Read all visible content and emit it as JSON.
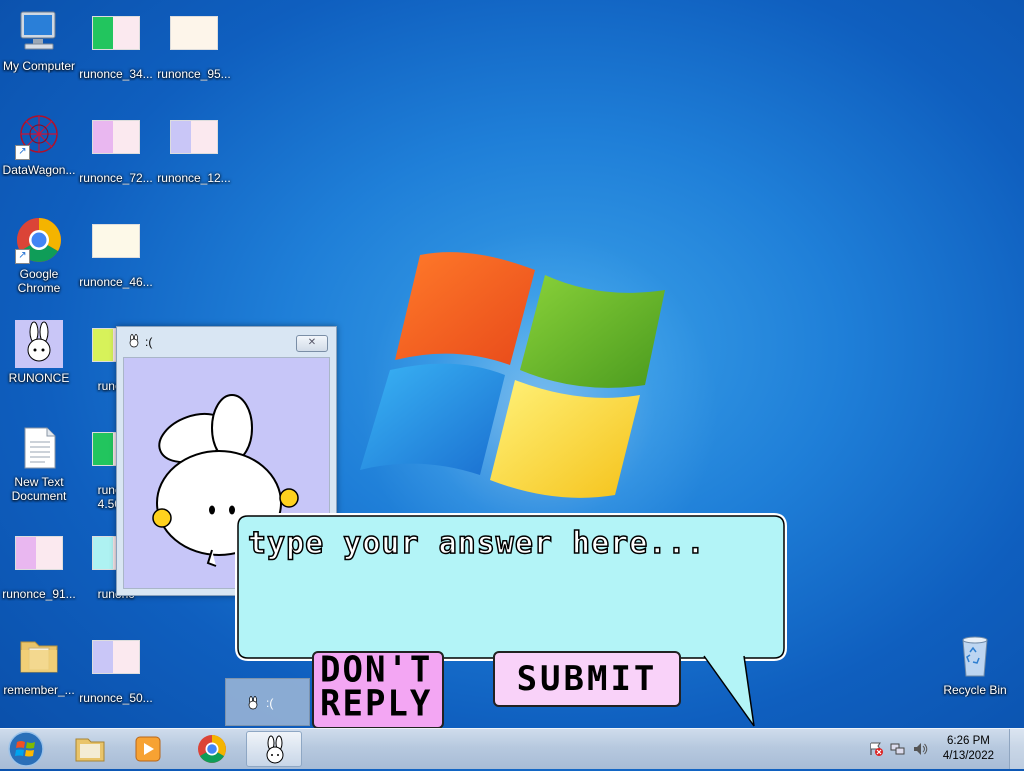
{
  "desktop": {
    "icons": [
      {
        "label": "My Computer"
      },
      {
        "label": "runonce_34..."
      },
      {
        "label": "runonce_95..."
      },
      {
        "label": "DataWagon..."
      },
      {
        "label": "runonce_72..."
      },
      {
        "label": "runonce_12..."
      },
      {
        "label": "Google Chrome"
      },
      {
        "label": "runonce_46..."
      },
      {
        "label": "RUNONCE"
      },
      {
        "label": "runonc"
      },
      {
        "label": "New Text Document"
      },
      {
        "label": "runonc"
      },
      {
        "label": "4.5088"
      },
      {
        "label": "runonce_91..."
      },
      {
        "label": "runonc"
      },
      {
        "label": "remember_..."
      },
      {
        "label": "runonce_50..."
      },
      {
        "label": "Recycle Bin"
      }
    ]
  },
  "popup_window": {
    "title": ":(",
    "close_glyph": "✕"
  },
  "dialog": {
    "answer_placeholder": "type your answer here...",
    "dont_reply_line1": "DON'T",
    "dont_reply_line2": "REPLY",
    "submit_label": "SUBMIT"
  },
  "minimized_tab": {
    "title": ":("
  },
  "taskbar": {
    "time": "6:26 PM",
    "date": "4/13/2022"
  },
  "colors": {
    "bubble_fill": "#b3f4f7",
    "dont_reply_fill": "#f3a6f3",
    "submit_fill": "#f9d2f9",
    "popup_client": "#c7c6f8"
  }
}
